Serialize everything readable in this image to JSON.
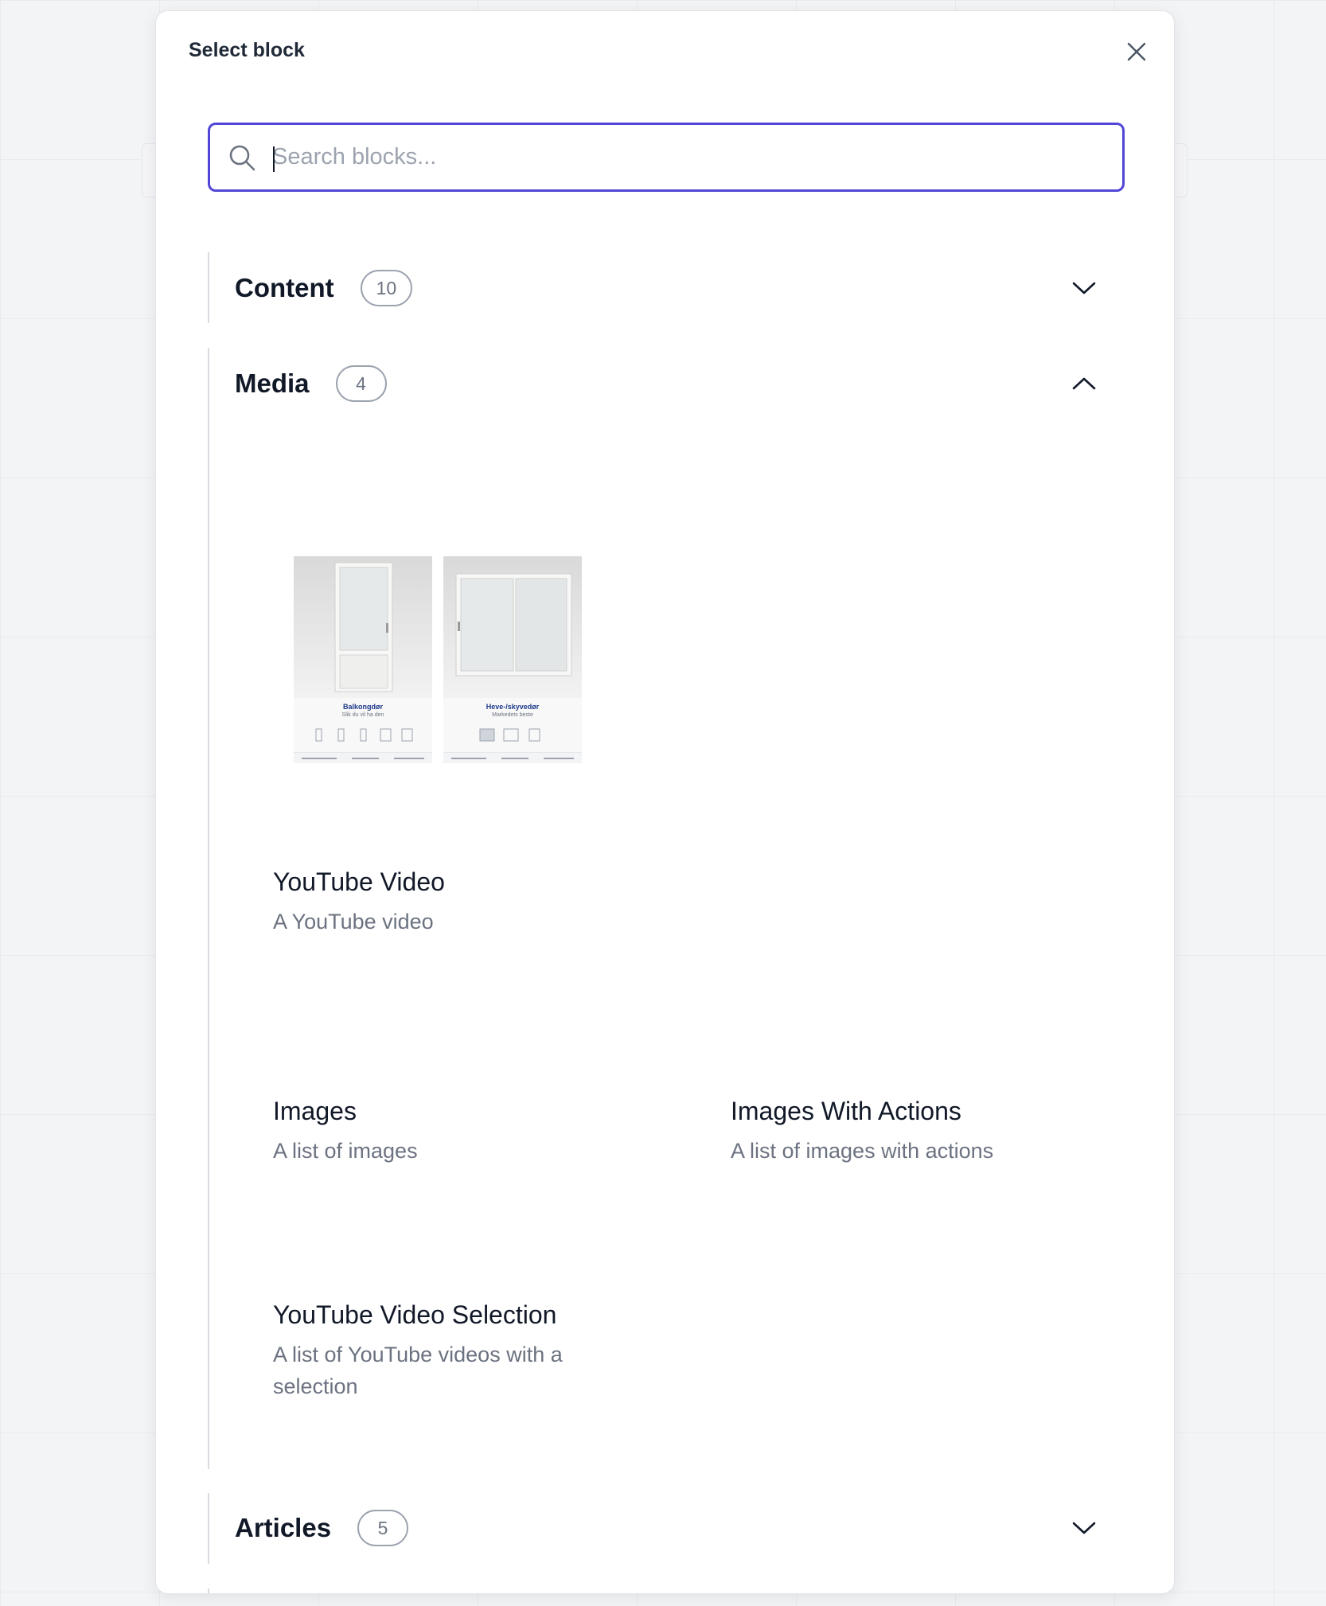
{
  "dialog": {
    "title": "Select block"
  },
  "search": {
    "placeholder": "Search blocks...",
    "value": ""
  },
  "sections": {
    "content": {
      "title": "Content",
      "count": "10",
      "state": "collapsed"
    },
    "media": {
      "title": "Media",
      "count": "4",
      "state": "expanded"
    },
    "articles": {
      "title": "Articles",
      "count": "5",
      "state": "collapsed"
    }
  },
  "previews": [
    {
      "caption_title": "Balkongdør",
      "caption_sub": "Slik du vil ha den"
    },
    {
      "caption_title": "Heve-/skyvedør",
      "caption_sub": "Markedets beste"
    }
  ],
  "media_blocks": [
    {
      "title": "YouTube Video",
      "description": "A YouTube video"
    },
    {
      "title": "Images",
      "description": "A list of images"
    },
    {
      "title": "Images With Actions",
      "description": "A list of images with actions"
    },
    {
      "title": "YouTube Video Selection",
      "description": "A list of YouTube videos with a selection"
    }
  ],
  "icons": {
    "close": "close-icon",
    "search": "search-icon",
    "collapsed": "chevron-down-icon",
    "expanded": "chevron-up-icon"
  },
  "colors": {
    "accent": "#5146d6",
    "text": "#111827",
    "muted": "#6b7280",
    "badge_border": "#9ca3af",
    "section_line": "#d9dbe0"
  }
}
